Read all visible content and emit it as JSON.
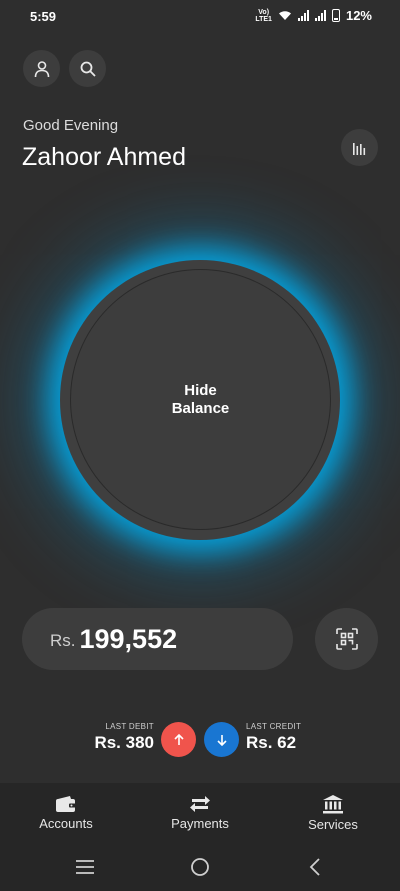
{
  "status_bar": {
    "time": "5:59",
    "volte": "Vo)\nLTE1",
    "battery": "12%"
  },
  "header": {
    "greeting": "Good Evening",
    "user_name": "Zahoor Ahmed",
    "profile_icon": "person-icon",
    "search_icon": "search-icon",
    "insights_icon": "bar-chart-icon"
  },
  "balance_circle": {
    "line1": "Hide",
    "line2": "Balance"
  },
  "balance": {
    "currency": "Rs.",
    "amount": "199,552",
    "scan_icon": "qr-scan-icon"
  },
  "transactions": {
    "debit_label": "LAST DEBIT",
    "debit_amount": "Rs. 380",
    "credit_label": "LAST CREDIT",
    "credit_amount": "Rs. 62",
    "debit_color": "#f0544c",
    "credit_color": "#1976d2"
  },
  "bottom_nav": {
    "items": [
      {
        "label": "Accounts",
        "icon": "wallet-icon"
      },
      {
        "label": "Payments",
        "icon": "transfer-icon"
      },
      {
        "label": "Services",
        "icon": "bank-icon"
      }
    ]
  },
  "colors": {
    "background": "#2e2e2e",
    "surface": "#3d3d3d",
    "glow": "#00aeef"
  }
}
